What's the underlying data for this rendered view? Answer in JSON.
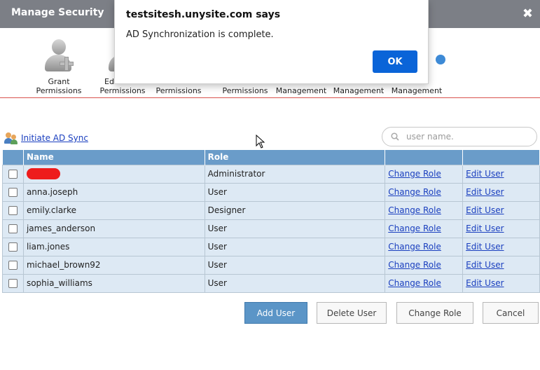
{
  "window": {
    "title": "Manage Security",
    "close_glyph": "✖"
  },
  "toolbar": {
    "items": [
      {
        "label_line1": "Grant",
        "label_line2": "Permissions",
        "icon": "grant-permissions-icon"
      },
      {
        "label_line1": "Ed",
        "label_line2": "Permissions",
        "icon": "edit-permissions-icon"
      },
      {
        "label_line1": "",
        "label_line2": "Permissions",
        "icon": "permissions-icon"
      },
      {
        "label_line1": "",
        "label_line2": "Permissions",
        "icon": "permissions-icon"
      },
      {
        "label_line1": "",
        "label_line2": "Management",
        "icon": "management-icon"
      },
      {
        "label_line1": "",
        "label_line2": "Management",
        "icon": "management-icon"
      },
      {
        "label_line1": "",
        "label_line2": "Management",
        "icon": "management-icon"
      }
    ]
  },
  "ad_sync": {
    "link_label": "Initiate AD Sync",
    "icon": "users-sync-icon"
  },
  "search": {
    "placeholder": "user name.",
    "value": ""
  },
  "table": {
    "headers": [
      "",
      "Name",
      "Role",
      "",
      ""
    ],
    "rows": [
      {
        "name": "",
        "redacted": true,
        "role": "Administrator",
        "change_role": "Change Role",
        "edit_user": "Edit User"
      },
      {
        "name": "anna.joseph",
        "role": "User",
        "change_role": "Change Role",
        "edit_user": "Edit User"
      },
      {
        "name": "emily.clarke",
        "role": "Designer",
        "change_role": "Change Role",
        "edit_user": "Edit User"
      },
      {
        "name": "james_anderson",
        "role": "User",
        "change_role": "Change Role",
        "edit_user": "Edit User"
      },
      {
        "name": "liam.jones",
        "role": "User",
        "change_role": "Change Role",
        "edit_user": "Edit User"
      },
      {
        "name": "michael_brown92",
        "role": "User",
        "change_role": "Change Role",
        "edit_user": "Edit User"
      },
      {
        "name": "sophia_williams",
        "role": "User",
        "change_role": "Change Role",
        "edit_user": "Edit User"
      }
    ]
  },
  "buttons": {
    "add_user": "Add User",
    "delete_user": "Delete User",
    "change_role": "Change Role",
    "cancel": "Cancel"
  },
  "alert": {
    "title": "testsitesh.unysite.com says",
    "message": "AD Synchronization is complete.",
    "ok_label": "OK"
  },
  "colors": {
    "titlebar": "#7c7f86",
    "table_header": "#6a9cc9",
    "table_row": "#dde9f4",
    "primary_button": "#5b95c7",
    "ok_button": "#0a64d8",
    "divider": "#d9534f"
  }
}
